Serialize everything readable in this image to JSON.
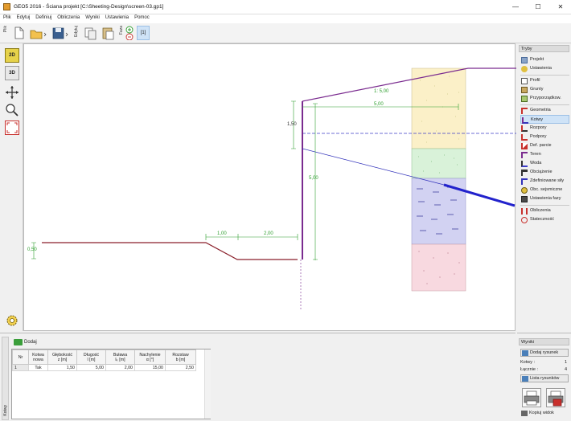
{
  "window": {
    "title": "GEO5 2016 - Ściana projekt [C:\\Sheeting-Design\\screen-03.gp1]",
    "minimize": "—",
    "maximize": "☐",
    "close": "✕"
  },
  "menu": [
    "Plik",
    "Edytuj",
    "Definiuj",
    "Obliczenia",
    "Wyniki",
    "Ustawienia",
    "Pomoc"
  ],
  "toolbar": {
    "file_label": "Plik",
    "edit_label": "Edytuj",
    "stage_label": "Faza",
    "stage_value": "[1]"
  },
  "left_tools": {
    "view_2d": "2D",
    "view_3d": "3D"
  },
  "right_panel": {
    "header": "Tryby",
    "items": [
      {
        "label": "Projekt",
        "icon": "project-icon"
      },
      {
        "label": "Ustawienia",
        "icon": "settings-icon"
      },
      {
        "label": "Profil",
        "icon": "profile-icon"
      },
      {
        "label": "Grunty",
        "icon": "soils-icon"
      },
      {
        "label": "Przyporządkow.",
        "icon": "assign-icon"
      },
      {
        "label": "Geometria",
        "icon": "geometry-icon"
      },
      {
        "label": "Kotwy",
        "icon": "anchors-icon"
      },
      {
        "label": "Rozpory",
        "icon": "props-icon"
      },
      {
        "label": "Podpory",
        "icon": "supports-icon"
      },
      {
        "label": "Def. parcie",
        "icon": "pressure-icon"
      },
      {
        "label": "Teren",
        "icon": "terrain-icon"
      },
      {
        "label": "Woda",
        "icon": "water-icon"
      },
      {
        "label": "Obciążenie",
        "icon": "surcharge-icon"
      },
      {
        "label": "Zdefiniowane siły",
        "icon": "forces-icon"
      },
      {
        "label": "Obc. sejsmiczne",
        "icon": "earthquake-icon"
      },
      {
        "label": "Ustawienia fazy",
        "icon": "stage-settings-icon"
      },
      {
        "label": "Obliczenia",
        "icon": "analysis-icon"
      },
      {
        "label": "Stateczność",
        "icon": "stability-icon"
      }
    ],
    "active": "Kotwy"
  },
  "drawing": {
    "dim_depth": "1,50",
    "dim_length": "5,00",
    "dim_length_h": "5,00",
    "slope": "1: 5,00",
    "dim_left_height": "0,50",
    "dim_berm_1": "1,00",
    "dim_berm_2": "2,00",
    "colors": {
      "wall": "#7a2b8f",
      "dim": "#2e9e2e",
      "anchor": "#3333bb",
      "water": "#3d3dc9",
      "ground": "#8a1f2a"
    },
    "soil_colors": [
      "#fbf0c8",
      "#d9f2d9",
      "#d2d2f2",
      "#f8d9e0"
    ]
  },
  "bottom": {
    "vertical_tab": "Kotwy",
    "add_button": "Dodaj",
    "columns": [
      [
        "Nr",
        ""
      ],
      [
        "Kotwa",
        "nowa"
      ],
      [
        "Głębokość",
        "z [m]"
      ],
      [
        "Długość",
        "l [m]"
      ],
      [
        "Buława",
        "lₖ [m]"
      ],
      [
        "Nachylenie",
        "α [°]"
      ],
      [
        "Rozstaw",
        "b [m]"
      ]
    ],
    "rows": [
      [
        "1",
        "Tak",
        "1,50",
        "5,00",
        "2,00",
        "15,00",
        "2,50"
      ]
    ]
  },
  "results": {
    "header": "Wyniki",
    "add_drawing": "Dodaj rysunek",
    "anchors_label": "Kotwy :",
    "anchors_value": "1",
    "total_label": "Łącznie :",
    "total_value": "4",
    "list_drawings": "Lista rysunków",
    "copy_view": "Kopiuj widok"
  }
}
